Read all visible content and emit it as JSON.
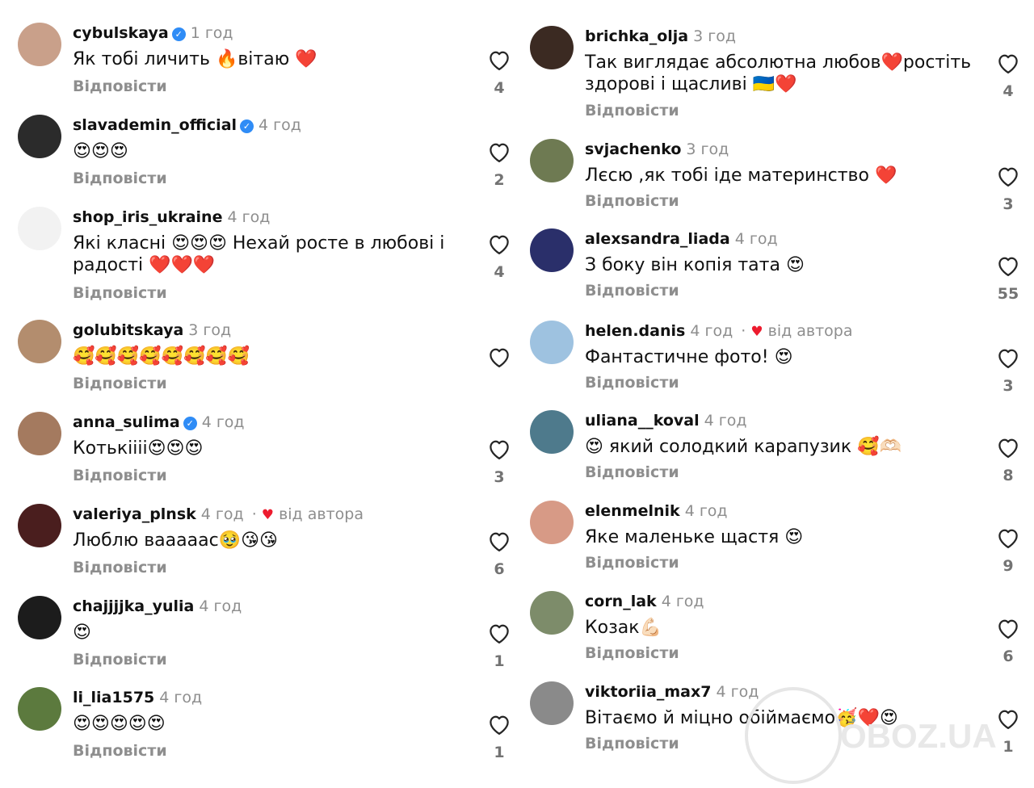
{
  "reply_label": "Відповісти",
  "left_comments": [
    {
      "user": "cybulskaya",
      "verified": true,
      "time": "1 год",
      "author_like": "",
      "text": "Як тобі личить 🔥вітаю ❤️",
      "likes": "4",
      "avatar_color": "#c9a08a"
    },
    {
      "user": "slavademin_official",
      "verified": true,
      "time": "4 год",
      "author_like": "",
      "text": "😍😍😍",
      "likes": "2",
      "avatar_color": "#2b2b2b"
    },
    {
      "user": "shop_iris_ukraine",
      "verified": false,
      "time": "4 год",
      "author_like": "",
      "text": "Які класні 😍😍😍 Нехай росте в любові і радості ❤️❤️❤️",
      "likes": "4",
      "avatar_color": "#f2f2f2"
    },
    {
      "user": "golubitskaya",
      "verified": false,
      "time": "3 год",
      "author_like": "",
      "text": "🥰🥰🥰🥰🥰🥰🥰🥰",
      "likes": "",
      "avatar_color": "#b38d6e"
    },
    {
      "user": "anna_sulima",
      "verified": true,
      "time": "4 год",
      "author_like": "",
      "text": "Котькіііі😍😍😍",
      "likes": "3",
      "avatar_color": "#a47a5f"
    },
    {
      "user": "valeriya_plnsk",
      "verified": false,
      "time": "4 год",
      "author_like": "від автора",
      "text": "Люблю вааааас🥹😘😘",
      "likes": "6",
      "avatar_color": "#4a1e1e"
    },
    {
      "user": "chajjjjka_yulia",
      "verified": false,
      "time": "4 год",
      "author_like": "",
      "text": "😍",
      "likes": "1",
      "avatar_color": "#1c1c1c"
    },
    {
      "user": "li_lia1575",
      "verified": false,
      "time": "4 год",
      "author_like": "",
      "text": "😍😍😍😍😍",
      "likes": "1",
      "avatar_color": "#5c7a3e"
    }
  ],
  "right_comments": [
    {
      "user": "brichka_olja",
      "verified": false,
      "time": "3 год",
      "author_like": "",
      "text": "Так виглядає абсолютна любов❤️ростіть здорові і щасливі 🇺🇦❤️",
      "likes": "4",
      "avatar_color": "#3b2a22"
    },
    {
      "user": "svjachenko",
      "verified": false,
      "time": "3 год",
      "author_like": "",
      "text": "Лєсю ,як тобі іде материнство ❤️",
      "likes": "3",
      "avatar_color": "#6e7a52"
    },
    {
      "user": "alexsandra_liada",
      "verified": false,
      "time": "4 год",
      "author_like": "",
      "text": "З боку він  копія тата 😍",
      "likes": "55",
      "avatar_color": "#2a2f6a"
    },
    {
      "user": "helen.danis",
      "verified": false,
      "time": "4 год",
      "author_like": "від автора",
      "text": "Фантастичне фото! 😍",
      "likes": "3",
      "avatar_color": "#9ec2e0"
    },
    {
      "user": "uliana__koval",
      "verified": false,
      "time": "4 год",
      "author_like": "",
      "text": "😍 який солодкий карапузик 🥰🫶🏻",
      "likes": "8",
      "avatar_color": "#4e7a8c"
    },
    {
      "user": "elenmelnik",
      "verified": false,
      "time": "4 год",
      "author_like": "",
      "text": "Яке маленьке щастя 😍",
      "likes": "9",
      "avatar_color": "#d79a86"
    },
    {
      "user": "corn_lak",
      "verified": false,
      "time": "4 год",
      "author_like": "",
      "text": "Козак💪🏻",
      "likes": "6",
      "avatar_color": "#7d8c6a"
    },
    {
      "user": "viktoriia_max7",
      "verified": false,
      "time": "4 год",
      "author_like": "",
      "text": "Вітаємо й міцно обіймаємо🥳❤️😍",
      "likes": "1",
      "avatar_color": "#8a8a8a"
    }
  ],
  "watermark": {
    "text": "OBOZ.UA"
  }
}
